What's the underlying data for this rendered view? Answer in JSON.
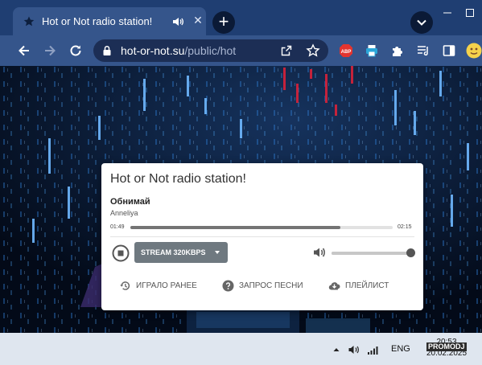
{
  "browser": {
    "tab": {
      "title": "Hot or Not radio station!"
    },
    "new_tab_label": "+",
    "close_tab_label": "✕",
    "address": {
      "host": "hot-or-not.su",
      "path": "/public/hot"
    },
    "extensions": [
      "adblock-plus-icon",
      "printer-icon",
      "extensions-puzzle-icon",
      "reading-list-icon",
      "side-panel-icon",
      "profile-avatar-icon"
    ],
    "abp_label": "ABP",
    "colors": {
      "tabstrip": "#1f3e72",
      "toolbar": "#35558b",
      "omnibox": "#1c2e55",
      "abp": "#e3342f"
    }
  },
  "player": {
    "station_title": "Hot or Not radio station!",
    "song": "Обнимай",
    "artist": "Anneliya",
    "elapsed": "01:49",
    "duration": "02:15",
    "progress": 0.8,
    "stream_label": "STREAM 320KBPS",
    "volume": 1.0,
    "actions": [
      {
        "label": "ИГРАЛО РАНЕЕ",
        "icon": "history-icon"
      },
      {
        "label": "ЗАПРОС ПЕСНИ",
        "icon": "help-circle-icon"
      },
      {
        "label": "ПЛЕЙЛИСТ",
        "icon": "cloud-download-icon"
      }
    ]
  },
  "taskbar": {
    "language": "ENG",
    "time": "20:53",
    "date": "20.02.2025",
    "watermark": "PROMODJ"
  }
}
